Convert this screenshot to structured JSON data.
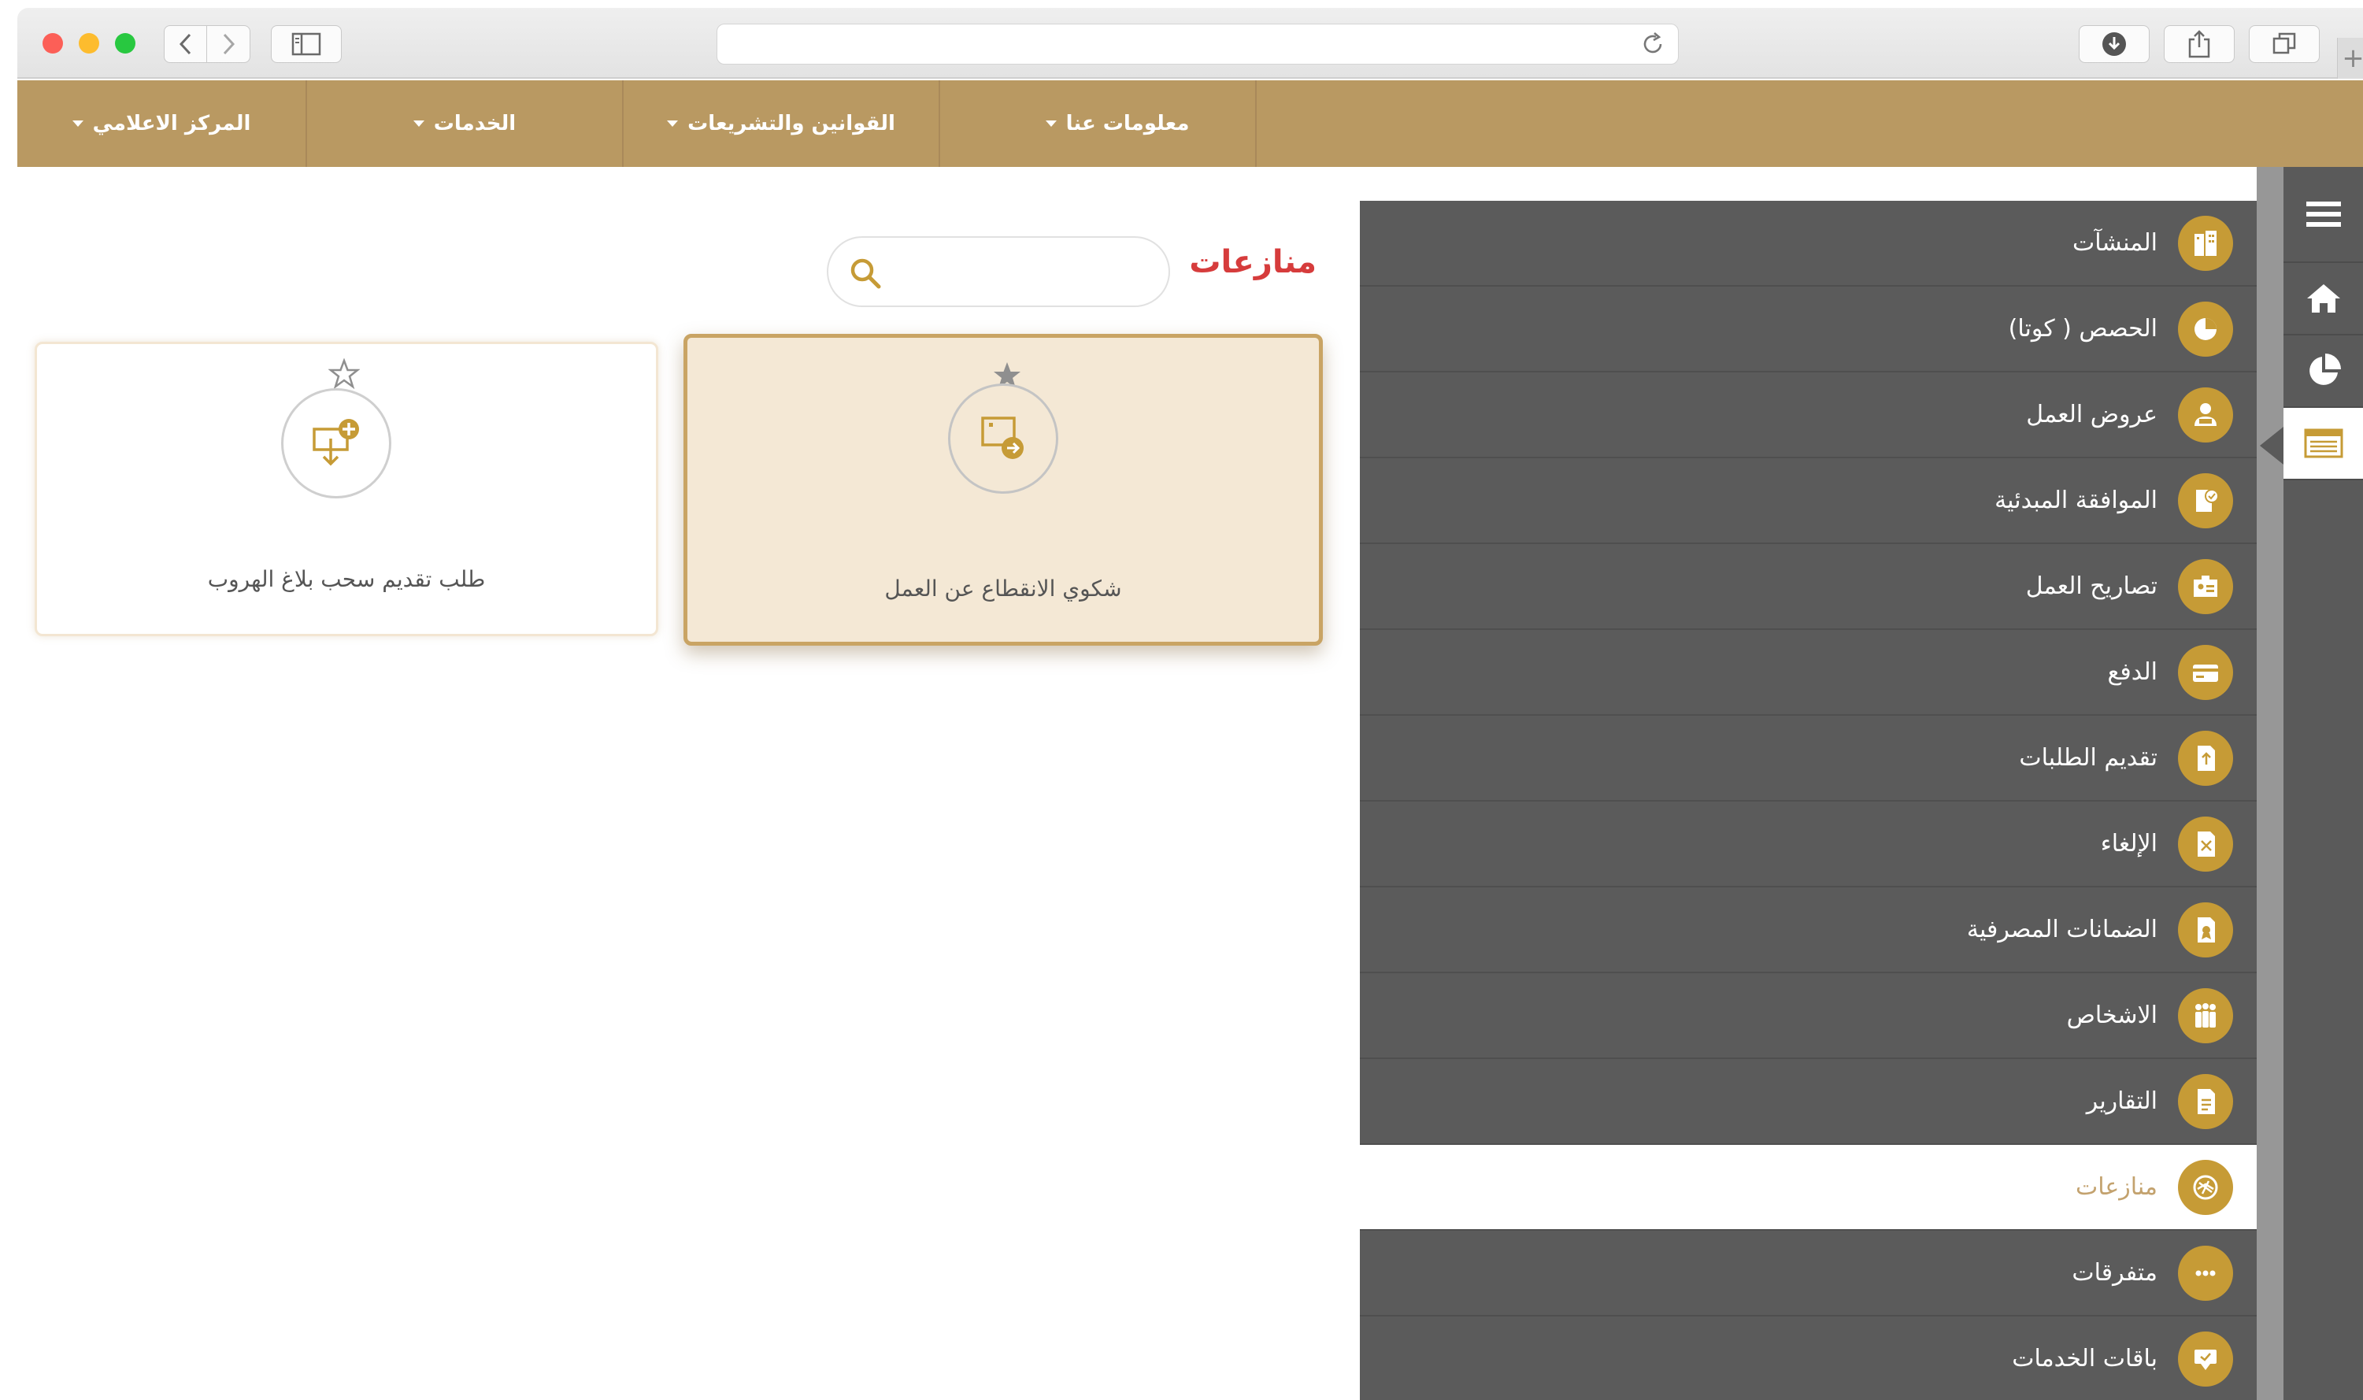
{
  "browser": {
    "new_tab_symbol": "+"
  },
  "topnav": {
    "items": [
      {
        "label": "معلومات عنا"
      },
      {
        "label": "القوانين والتشريعات"
      },
      {
        "label": "الخدمات"
      },
      {
        "label": "المركز الاعلامي"
      }
    ]
  },
  "rail": {
    "items": [
      {
        "icon": "hamburger-menu-icon"
      },
      {
        "icon": "home-icon"
      },
      {
        "icon": "pie-chart-icon"
      },
      {
        "icon": "list-card-icon",
        "active": true
      }
    ]
  },
  "menu": {
    "items": [
      {
        "label": "المنشآت",
        "icon": "building-icon"
      },
      {
        "label": "الحصص ( كوتا)",
        "icon": "quota-pie-icon"
      },
      {
        "label": "عروض العمل",
        "icon": "job-offer-icon"
      },
      {
        "label": "الموافقة المبدئية",
        "icon": "approval-document-icon"
      },
      {
        "label": "تصاريح العمل",
        "icon": "work-permit-icon"
      },
      {
        "label": "الدفع",
        "icon": "payment-card-icon"
      },
      {
        "label": "تقديم الطلبات",
        "icon": "submit-request-icon"
      },
      {
        "label": "الإلغاء",
        "icon": "cancel-document-icon"
      },
      {
        "label": "الضمانات المصرفية",
        "icon": "bank-guarantee-icon"
      },
      {
        "label": "الاشخاص",
        "icon": "people-icon"
      },
      {
        "label": "التقارير",
        "icon": "reports-icon"
      },
      {
        "label": "منازعات",
        "icon": "disputes-icon",
        "active": true
      },
      {
        "label": "متفرقات",
        "icon": "more-dots-icon"
      },
      {
        "label": "باقات الخدمات",
        "icon": "service-packages-icon"
      }
    ]
  },
  "main": {
    "title": "منازعات",
    "search": {
      "value": "",
      "placeholder": ""
    },
    "cards": [
      {
        "label": "شكوي الانقطاع عن العمل",
        "icon": "work-absence-complaint-icon",
        "starred": true,
        "highlighted": true
      },
      {
        "label": "طلب تقديم سحب بلاغ الهروب",
        "icon": "withdraw-absconding-report-icon",
        "starred": false,
        "highlighted": false
      }
    ]
  },
  "colors": {
    "accent_gold": "#b99962",
    "menu_dark": "#5b5b5b",
    "icon_gold": "#c69b36",
    "title_red": "#d63c3c"
  }
}
